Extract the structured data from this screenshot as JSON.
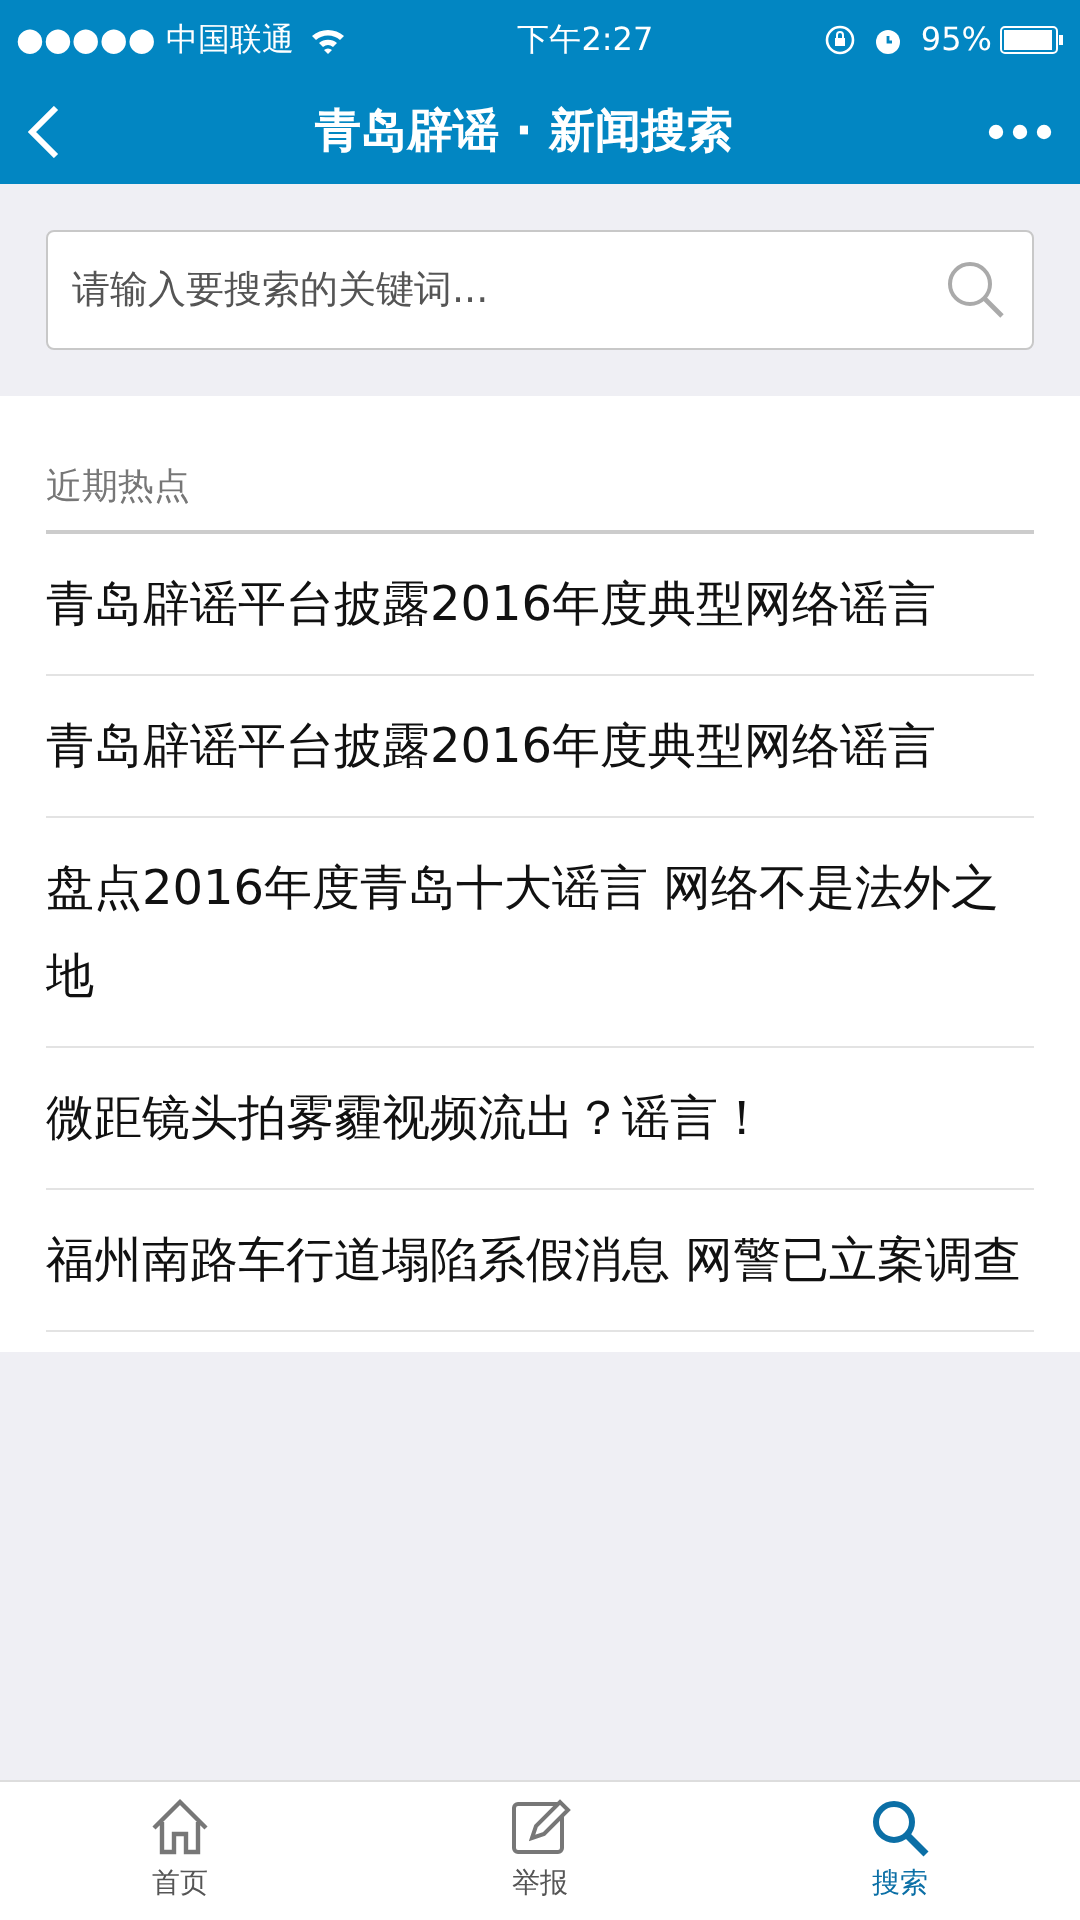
{
  "status_bar": {
    "carrier": "●●●●● 中国联通",
    "time": "下午2:27",
    "battery": "95%"
  },
  "nav": {
    "title": "青岛辟谣 · 新闻搜索"
  },
  "search": {
    "placeholder": "请输入要搜索的关键词..."
  },
  "section": {
    "title": "近期热点"
  },
  "news": [
    {
      "title": "青岛辟谣平台披露2016年度典型网络谣言"
    },
    {
      "title": "青岛辟谣平台披露2016年度典型网络谣言"
    },
    {
      "title": "盘点2016年度青岛十大谣言 网络不是法外之地"
    },
    {
      "title": "微距镜头拍雾霾视频流出？谣言！"
    },
    {
      "title": "福州南路车行道塌陷系假消息 网警已立案调查"
    }
  ],
  "tab_bar": [
    {
      "kind": "home",
      "label": "首页",
      "selected": false
    },
    {
      "kind": "report",
      "label": "举报",
      "selected": false
    },
    {
      "kind": "search",
      "label": "搜索",
      "selected": true
    }
  ]
}
